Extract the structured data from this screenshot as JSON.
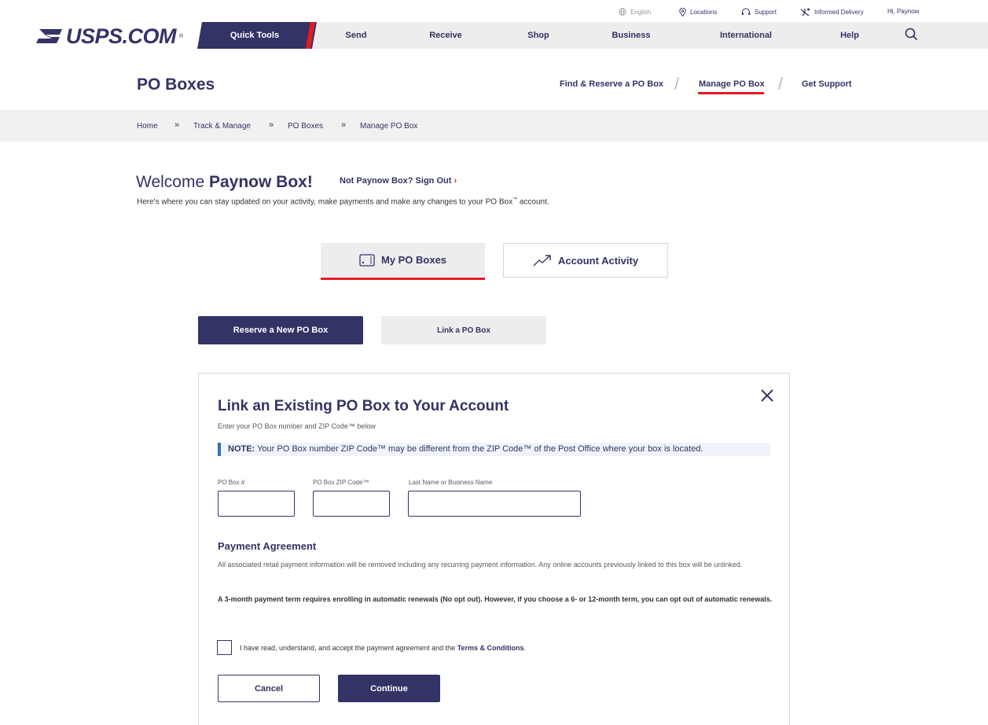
{
  "utility_bar": {
    "language": "English",
    "locations": "Locations",
    "support": "Support",
    "informed_delivery": "Informed Delivery",
    "greeting": "Hi, Paynow"
  },
  "nav": {
    "logo": "USPS.COM",
    "logo_mark": "®",
    "items": [
      "Quick Tools",
      "Send",
      "Receive",
      "Shop",
      "Business",
      "International",
      "Help"
    ]
  },
  "header": {
    "title": "PO Boxes",
    "links": [
      "Find & Reserve a PO Box",
      "Manage PO Box",
      "Get Support"
    ],
    "active_link": "Manage PO Box"
  },
  "breadcrumb": [
    "Home",
    "Track & Manage",
    "PO Boxes",
    "Manage PO Box"
  ],
  "breadcrumb_sep": "»",
  "welcome": {
    "prefix": "Welcome ",
    "name": "Paynow Box!",
    "not_user": "Not Paynow Box? Sign Out",
    "chevron": "›",
    "intro": "Here's where you can stay updated on your activity, make payments and make any changes to your PO Box",
    "intro_tm": "™",
    "intro_end": " account."
  },
  "tabs": {
    "my_boxes": "My PO Boxes",
    "activity": "Account Activity"
  },
  "actions": {
    "reserve": "Reserve a New PO Box",
    "link": "Link a PO Box"
  },
  "modal": {
    "title": "Link an Existing PO Box to Your Account",
    "subtitle": "Enter your PO Box number and ZIP Code™ below",
    "note_label": "NOTE:",
    "note_text": " Your PO Box number ZIP Code™ may be different from the ZIP Code™ of the Post Office where your box is located.",
    "fields": {
      "po_box_label": "PO Box #",
      "zip_label": "PO Box ZIP Code™",
      "name_label": "Last Name or Business Name",
      "po_box_value": "",
      "zip_value": "",
      "name_value": ""
    },
    "payment_title": "Payment Agreement",
    "payment_text": "All associated retail payment information will be removed including any recurring payment information. Any online accounts previously linked to this box will be unlinked.",
    "payment_bold": "A 3-month payment term requires enrolling in automatic renewals (No opt out). However, if you choose a 6- or 12-month term, you can opt out of automatic renewals.",
    "agree_text": "I have read, understand, and accept the payment agreement and the ",
    "agree_terms": "Terms & Conditions",
    "agree_end": ".",
    "agree_checked": false,
    "cancel": "Cancel",
    "continue": "Continue"
  },
  "colors": {
    "brand_navy": "#333366",
    "brand_red": "#e71921",
    "note_blue": "#3573b1"
  }
}
